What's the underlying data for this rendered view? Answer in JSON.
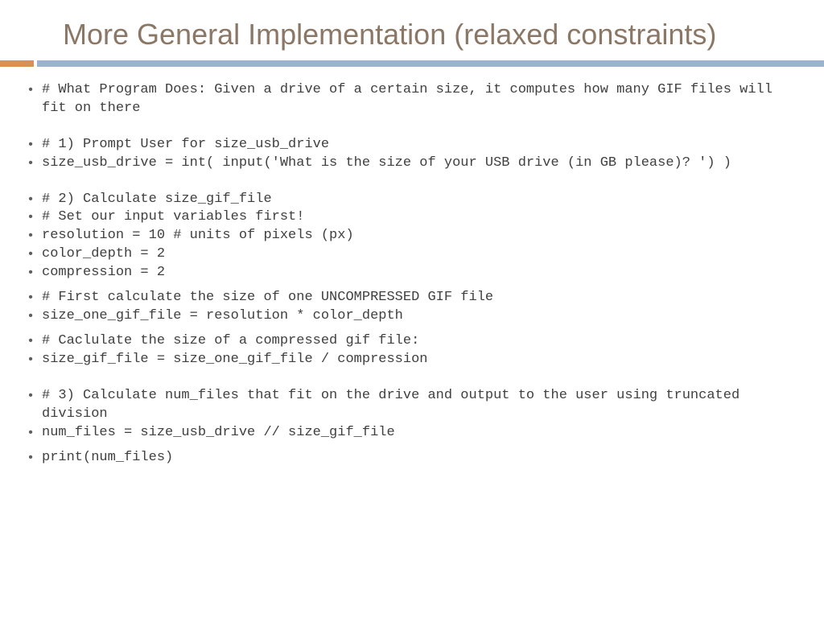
{
  "title": "More General Implementation (relaxed constraints)",
  "lines": {
    "l1": "# What Program Does: Given a drive of a certain size, it computes how many GIF files will fit on there",
    "l2": "# 1) Prompt User for size_usb_drive",
    "l3": "size_usb_drive = int( input('What is the size of your USB drive (in GB please)?  ') )",
    "l4": "# 2) Calculate size_gif_file",
    "l5": "# Set our input variables first!",
    "l6": "resolution = 10   # units of pixels (px)",
    "l7": "color_depth = 2",
    "l8": "compression = 2",
    "l9": "# First calculate the size of one UNCOMPRESSED GIF file",
    "l10": "size_one_gif_file = resolution * color_depth",
    "l11": "# Caclulate the size of a compressed gif file:",
    "l12": "size_gif_file = size_one_gif_file / compression",
    "l13": "# 3) Calculate num_files that fit on the drive and output to the user using truncated division",
    "l14": "num_files = size_usb_drive // size_gif_file",
    "l15": "print(num_files)"
  }
}
